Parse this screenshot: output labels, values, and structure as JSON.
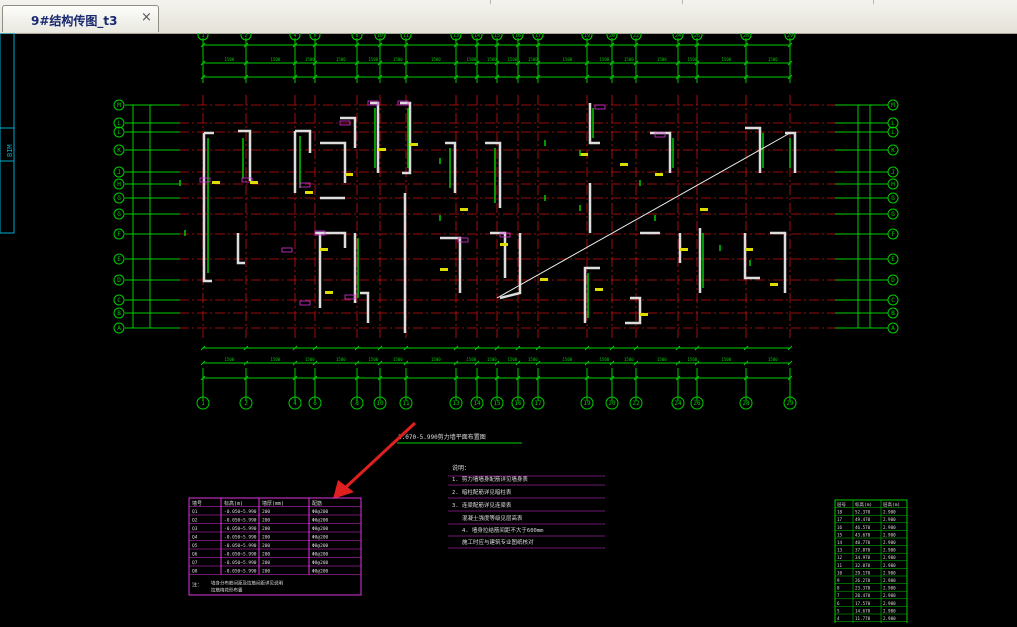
{
  "tab": {
    "title": "9#结构传图_t3",
    "close_glyph": "×"
  },
  "drawing": {
    "plan_title": "2.070-5.990剪力墙平面布置图",
    "left_panel_text": "BIM",
    "top_axes": [
      "1",
      "2",
      "4",
      "6",
      "8",
      "10",
      "11",
      "13",
      "14",
      "15",
      "16",
      "17",
      "19",
      "20",
      "22",
      "24",
      "26",
      "28",
      "29"
    ],
    "bottom_axes": [
      "1",
      "2",
      "4",
      "6",
      "8",
      "10",
      "11",
      "13",
      "14",
      "15",
      "16",
      "17",
      "19",
      "20",
      "22",
      "24",
      "26",
      "28",
      "29"
    ],
    "row_axes": [
      "M",
      "L",
      "K",
      "J",
      "H",
      "G",
      "F",
      "E",
      "D",
      "C",
      "B",
      "A"
    ],
    "notes_title": "说明：",
    "notes": [
      "1. 剪力墙墙身配筋详见墙身表",
      "2. 暗柱配筋详见暗柱表",
      "3. 连梁配筋详见连梁表"
    ],
    "notes_extra": [
      "混凝土强度等级见层高表",
      "4. 墙身拉结筋间距不大于600mm",
      "施工时应与建筑专业图纸核对"
    ],
    "table_left": {
      "headers": [
        "墙号",
        "标高(m)",
        "墙厚(mm)",
        "配筋"
      ],
      "rows": [
        [
          "Q1",
          "-0.050~5.990",
          "200",
          "Φ8@200"
        ],
        [
          "Q2",
          "-0.050~5.990",
          "200",
          "Φ8@200"
        ],
        [
          "Q3",
          "-0.050~5.990",
          "200",
          "Φ8@200"
        ],
        [
          "Q4",
          "-0.050~5.990",
          "200",
          "Φ8@200"
        ],
        [
          "Q5",
          "-0.050~5.990",
          "200",
          "Φ8@200"
        ],
        [
          "Q6",
          "-0.050~5.990",
          "200",
          "Φ8@200"
        ],
        [
          "Q7",
          "-0.050~5.990",
          "200",
          "Φ8@200"
        ],
        [
          "Q8",
          "-0.050~5.990",
          "200",
          "Φ8@200"
        ]
      ],
      "note_label": "注：",
      "note_lines": [
        "墙身分布筋间距及拉筋间距详见说明",
        "拉筋梅花形布置"
      ]
    },
    "table_right": {
      "headers": [
        "层号",
        "标高(m)",
        "层高(m)"
      ],
      "rows": [
        [
          "18",
          "52.370",
          "2.900"
        ],
        [
          "17",
          "49.470",
          "2.900"
        ],
        [
          "16",
          "46.570",
          "2.900"
        ],
        [
          "15",
          "43.670",
          "2.900"
        ],
        [
          "14",
          "40.770",
          "2.900"
        ],
        [
          "13",
          "37.870",
          "2.900"
        ],
        [
          "12",
          "34.970",
          "2.900"
        ],
        [
          "11",
          "32.070",
          "2.900"
        ],
        [
          "10",
          "29.170",
          "2.900"
        ],
        [
          "9",
          "26.270",
          "2.900"
        ],
        [
          "8",
          "23.370",
          "2.900"
        ],
        [
          "7",
          "20.470",
          "2.900"
        ],
        [
          "6",
          "17.570",
          "2.900"
        ],
        [
          "5",
          "14.670",
          "2.900"
        ],
        [
          "4",
          "11.770",
          "2.900"
        ],
        [
          "3",
          "8.870",
          "2.900"
        ],
        [
          "2",
          "5.990",
          "2.900"
        ],
        [
          "1",
          "-0.050",
          "3.000"
        ]
      ]
    },
    "colors": {
      "background": "#000000",
      "grid_green": "#00cc00",
      "axis_red": "#cc1111",
      "wall_white": "#dddddd",
      "label_magenta": "#dd33dd",
      "annotation_yellow": "#dddd00",
      "arrow_red": "#e02020"
    }
  }
}
